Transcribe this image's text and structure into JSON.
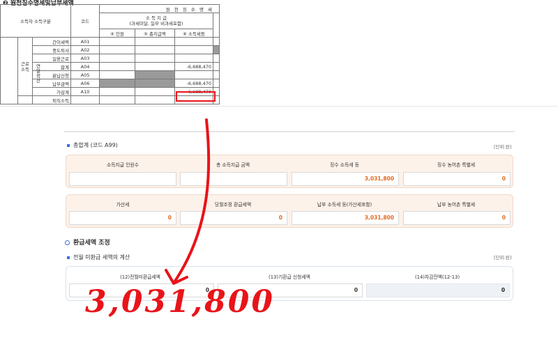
{
  "report": {
    "title": "❷ 원천징수명세및납부세액",
    "header_group": "원 천 징 수 명 세",
    "col_type": "소득자 소득구분",
    "col_code": "코드",
    "col_payment": "소 득 지 급",
    "col_payment_sub": "(과세미달, 일부 비과세포함)",
    "col_persons": "④ 인원",
    "col_total": "⑤ 총지급액",
    "col_tax": "⑥ 소득세등",
    "group_labor": "근로 소득",
    "group_yearend": "연말 정산",
    "rows": [
      {
        "label": "간이세액",
        "code": "A01",
        "tax": ""
      },
      {
        "label": "중도퇴사",
        "code": "A02",
        "tax": ""
      },
      {
        "label": "일용근로",
        "code": "A03",
        "tax": ""
      },
      {
        "label": "합계",
        "code": "A04",
        "tax": "-6,688,470"
      },
      {
        "label": "분납신청",
        "code": "A05",
        "tax": ""
      },
      {
        "label": "납부금액",
        "code": "A06",
        "tax": "-6,688,470"
      },
      {
        "label": "가감계",
        "code": "A10",
        "tax": "-6,688,470"
      },
      {
        "label": "퇴직소득",
        "code": "",
        "tax": ""
      }
    ]
  },
  "summary": {
    "title": "총합계 (코드 A99)",
    "unit": "[단위:원]",
    "row1": [
      {
        "label": "소득지급 인원수",
        "value": ""
      },
      {
        "label": "총 소득지급 금액",
        "value": ""
      },
      {
        "label": "징수 소득세 등",
        "value": "3,031,800"
      },
      {
        "label": "징수 농어촌 특별세",
        "value": "0"
      }
    ],
    "row2": [
      {
        "label": "가산세",
        "value": "0"
      },
      {
        "label": "당월조정 환급세액",
        "value": "0"
      },
      {
        "label": "납부 소득세 등(가산세포함)",
        "value": "3,031,800"
      },
      {
        "label": "납부 농어촌 특별세",
        "value": "0"
      }
    ]
  },
  "refund": {
    "title": "환급세액 조정",
    "sub_title": "전월 미환급 세액의 계산",
    "unit": "[단위:원]",
    "fields": [
      {
        "label": "(12)전월미환급세액",
        "value": "0"
      },
      {
        "label": "(13)기환급 신청세액",
        "value": "0"
      },
      {
        "label": "(14)차감잔액(12-13)",
        "value": "0"
      }
    ]
  },
  "annotation": {
    "handwritten": "3,031,800",
    "color": "#e8141a"
  }
}
